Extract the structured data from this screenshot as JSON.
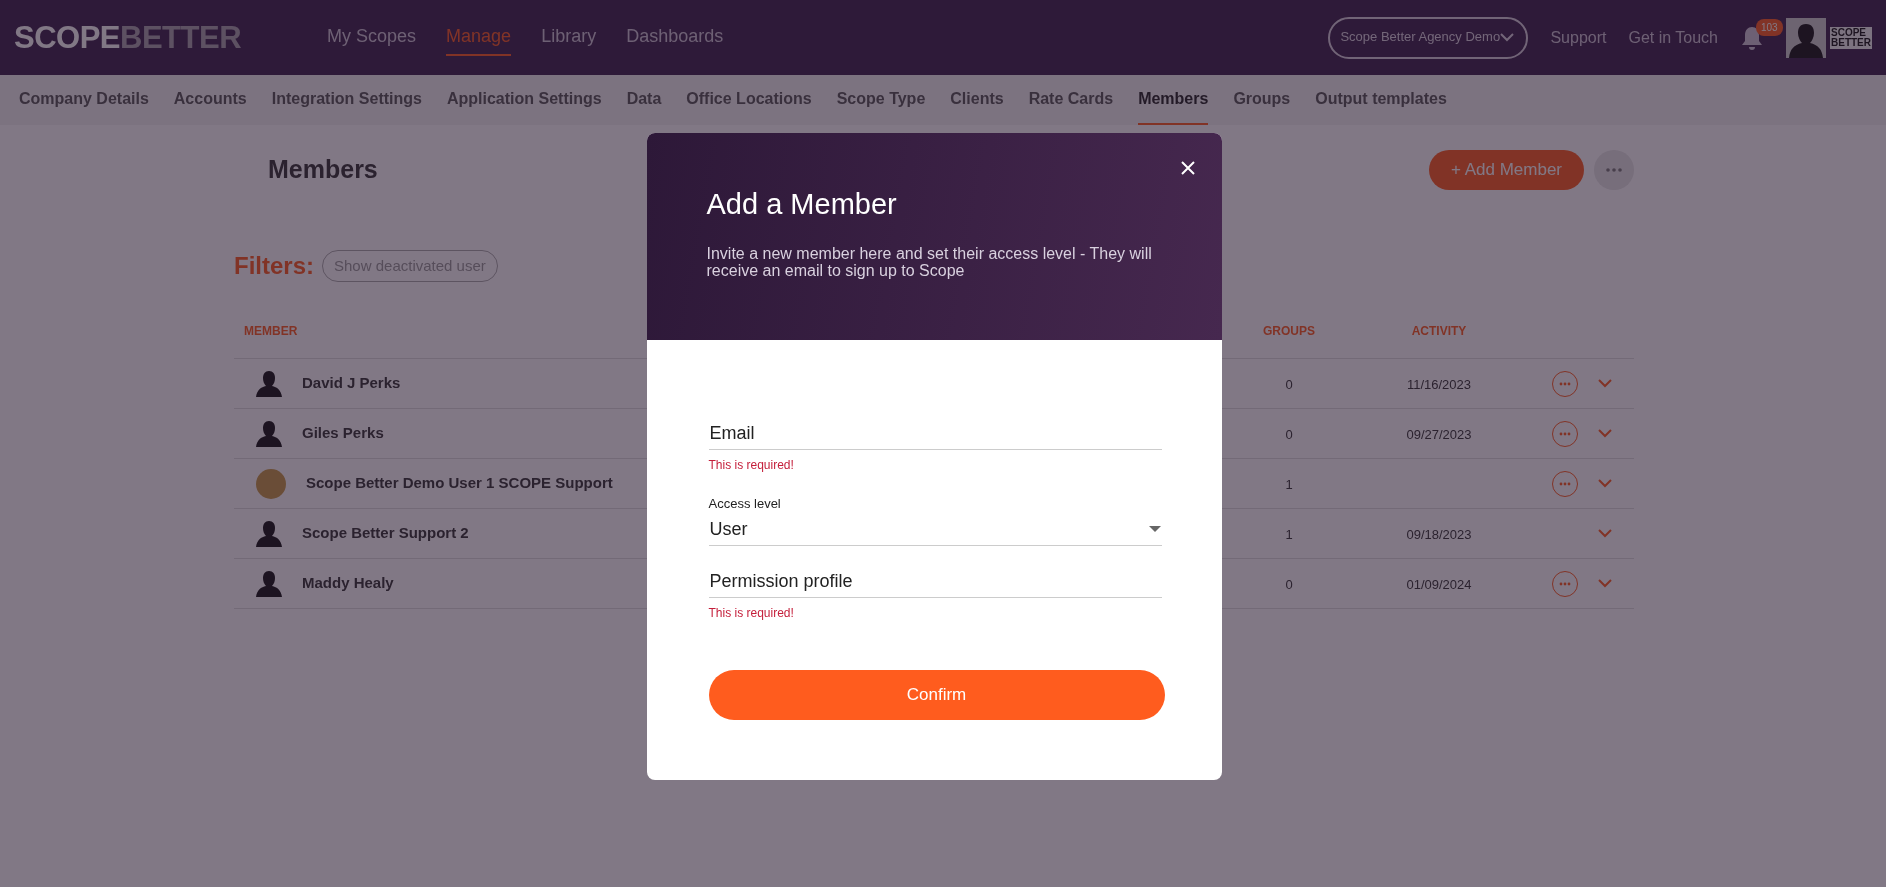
{
  "logo": {
    "parts": [
      "SCOPE",
      "BETTER"
    ]
  },
  "main_nav": [
    {
      "label": "My Scopes",
      "selected": false
    },
    {
      "label": "Manage",
      "selected": true
    },
    {
      "label": "Library",
      "selected": false
    },
    {
      "label": "Dashboards",
      "selected": false
    }
  ],
  "agency_select": {
    "value": "Scope Better Agency Demo"
  },
  "header_links": [
    "Support",
    "Get in Touch"
  ],
  "notifications": {
    "count": "103"
  },
  "account_logo": {
    "lines": [
      "SCOPE",
      "BETTER"
    ]
  },
  "sub_nav": [
    {
      "label": "Company Details",
      "selected": false
    },
    {
      "label": "Accounts",
      "selected": false
    },
    {
      "label": "Integration Settings",
      "selected": false
    },
    {
      "label": "Application Settings",
      "selected": false
    },
    {
      "label": "Data",
      "selected": false
    },
    {
      "label": "Office Locations",
      "selected": false
    },
    {
      "label": "Scope Type",
      "selected": false
    },
    {
      "label": "Clients",
      "selected": false
    },
    {
      "label": "Rate Cards",
      "selected": false
    },
    {
      "label": "Members",
      "selected": true
    },
    {
      "label": "Groups",
      "selected": false
    },
    {
      "label": "Output templates",
      "selected": false
    }
  ],
  "page": {
    "title": "Members",
    "add_button": "+ Add Member",
    "filters_label": "Filters:",
    "filter_chip": "Show deactivated user"
  },
  "table": {
    "columns": [
      "MEMBER",
      "GROUPS",
      "ACTIVITY"
    ],
    "rows": [
      {
        "avatar": {
          "kind": "silhouette"
        },
        "name": "David J Perks",
        "groups": "0",
        "activity": "11/16/2023",
        "menu": true
      },
      {
        "avatar": {
          "kind": "silhouette"
        },
        "name": "Giles Perks",
        "groups": "0",
        "activity": "09/27/2023",
        "menu": true
      },
      {
        "avatar": {
          "kind": "photo"
        },
        "name": "Scope Better Demo User 1 SCOPE Support",
        "groups": "1",
        "menu": true
      },
      {
        "avatar": {
          "kind": "silhouette"
        },
        "name": "Scope Better Support 2",
        "groups": "1",
        "activity": "09/18/2023",
        "menu": false
      },
      {
        "avatar": {
          "kind": "silhouette"
        },
        "name": "Maddy Healy",
        "groups": "0",
        "activity": "01/09/2024",
        "menu": true
      }
    ]
  },
  "modal": {
    "title": "Add a Member",
    "subtitle": "Invite a new member here and set their access level - They will receive an email to sign up to Scope",
    "fields": [
      {
        "kind": "text",
        "placeholder": "Email",
        "error": "This is required!"
      },
      {
        "kind": "select",
        "label": "Access level",
        "value": "User"
      },
      {
        "kind": "text",
        "placeholder": "Permission profile",
        "error": "This is required!"
      }
    ],
    "confirm": "Confirm"
  }
}
